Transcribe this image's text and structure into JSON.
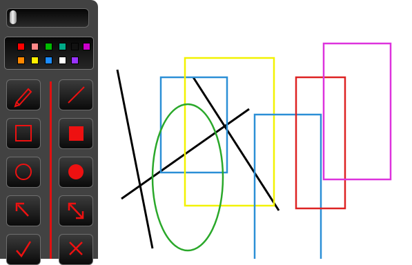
{
  "colors": {
    "toolbar_bg": "#424242",
    "accent": "#e01010"
  },
  "palette": {
    "swatches": [
      "#ff0000",
      "#ff8888",
      "#00bb00",
      "#00aa88",
      "#111111",
      "#cc00cc",
      "#ff8800",
      "#ffee00",
      "#1c8cff",
      "#ffffff",
      "#9933ff"
    ]
  },
  "tools": [
    {
      "icon": "pencil-icon"
    },
    {
      "icon": "line-icon"
    },
    {
      "icon": "rectangle-outline-icon"
    },
    {
      "icon": "rectangle-filled-icon"
    },
    {
      "icon": "circle-outline-icon"
    },
    {
      "icon": "circle-filled-icon"
    },
    {
      "icon": "arrow-icon"
    },
    {
      "icon": "double-arrow-icon"
    },
    {
      "icon": "checkmark-icon"
    },
    {
      "icon": "cross-icon"
    }
  ],
  "drawing": {
    "shapes": [
      {
        "type": "line",
        "color": "#000000"
      },
      {
        "type": "line",
        "color": "#000000"
      },
      {
        "type": "line",
        "color": "#000000"
      },
      {
        "type": "rect",
        "color": "#2b8fd6"
      },
      {
        "type": "rect",
        "color": "#f2f200"
      },
      {
        "type": "ellipse",
        "color": "#2aa82a"
      },
      {
        "type": "rect",
        "color": "#2b8fd6"
      },
      {
        "type": "rect",
        "color": "#dd2222"
      },
      {
        "type": "rect",
        "color": "#dd33dd"
      }
    ]
  }
}
